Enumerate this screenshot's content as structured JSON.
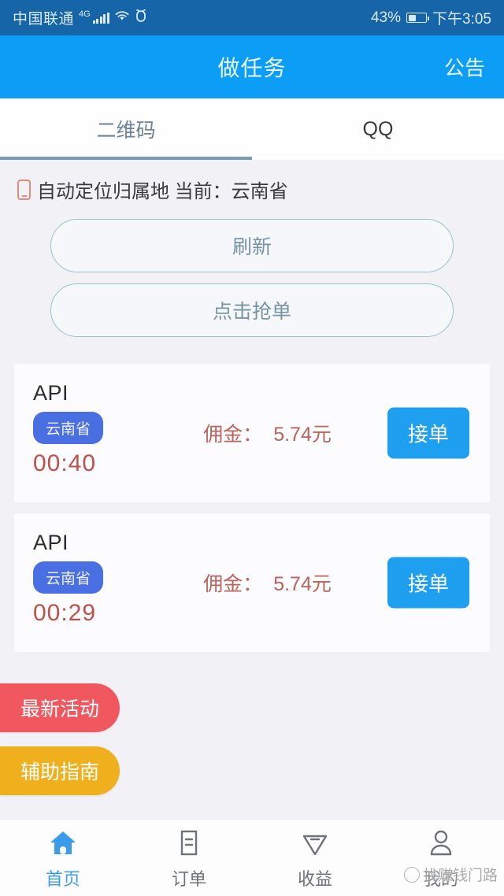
{
  "statusbar": {
    "carrier": "中国联通",
    "network": "4G",
    "signal_icon": "signal-bars-icon",
    "wifi_icon": "wifi-icon",
    "security_icon": "shield-icon",
    "battery_percent": "43%",
    "battery_level": 43,
    "time": "下午3:05"
  },
  "header": {
    "title": "做任务",
    "action_label": "公告"
  },
  "tabs": [
    {
      "label": "二维码",
      "active": true
    },
    {
      "label": "QQ",
      "active": false
    }
  ],
  "location": {
    "icon": "phone-icon",
    "text": "自动定位归属地 当前：云南省"
  },
  "actions": {
    "refresh_label": "刷新",
    "grab_label": "点击抢单"
  },
  "task_cards": [
    {
      "title": "API",
      "region": "云南省",
      "timer": "00:40",
      "fee_label": "佣金：",
      "fee_amount": "5.74元",
      "accept_label": "接单"
    },
    {
      "title": "API",
      "region": "云南省",
      "timer": "00:29",
      "fee_label": "佣金：",
      "fee_amount": "5.74元",
      "accept_label": "接单"
    }
  ],
  "float_buttons": [
    {
      "label": "最新活动",
      "color": "#f0575f"
    },
    {
      "label": "辅助指南",
      "color": "#f0b01d"
    }
  ],
  "bottom_nav": [
    {
      "label": "首页",
      "icon": "home-icon",
      "active": true
    },
    {
      "label": "订单",
      "icon": "document-icon",
      "active": false
    },
    {
      "label": "收益",
      "icon": "diamond-icon",
      "active": false
    },
    {
      "label": "我的",
      "icon": "person-icon",
      "active": false
    }
  ],
  "watermark": {
    "text": "找赚钱门路"
  },
  "colors": {
    "header_blue": "#0c9ef7",
    "statusbar_blue": "#1565a8",
    "accept_blue": "#1f9ff0",
    "badge_blue": "#4a6fe3",
    "timer_red": "#c0504a",
    "fee_red": "#b9635c",
    "page_bg": "#f2f2f6"
  }
}
